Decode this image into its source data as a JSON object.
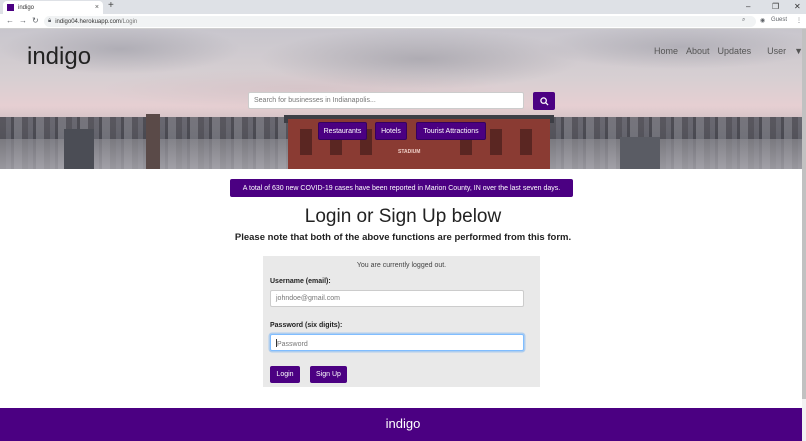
{
  "browser": {
    "tab_title": "indigo",
    "tab_close": "×",
    "new_tab": "+",
    "url_host": "indigo04.herokuapp.com",
    "url_path": "/Login",
    "profile_label": "Guest",
    "controls": {
      "minimize": "–",
      "restore": "❐",
      "close": "✕"
    }
  },
  "navbar": {
    "brand": "indigo",
    "links": [
      "Home",
      "About",
      "Updates",
      "User"
    ]
  },
  "search": {
    "placeholder": "Search for businesses in Indianapolis..."
  },
  "categories": [
    "Restaurants",
    "Hotels",
    "Tourist Attractions"
  ],
  "hero": {
    "stadium_sign": "STADIUM"
  },
  "alert": {
    "text": "A total of 630 new COVID-19 cases have been reported in Marion County, IN over the last seven days."
  },
  "main": {
    "title": "Login or Sign Up below",
    "subtitle": "Please note that both of the above functions are performed from this form."
  },
  "form": {
    "status": "You are currently logged out.",
    "username_label": "Username (email):",
    "username_placeholder": "johndoe@gmail.com",
    "password_label": "Password (six digits):",
    "password_placeholder": "Password",
    "login_label": "Login",
    "signup_label": "Sign Up"
  },
  "footer": {
    "brand": "indigo"
  },
  "colors": {
    "accent": "#4b0082"
  }
}
